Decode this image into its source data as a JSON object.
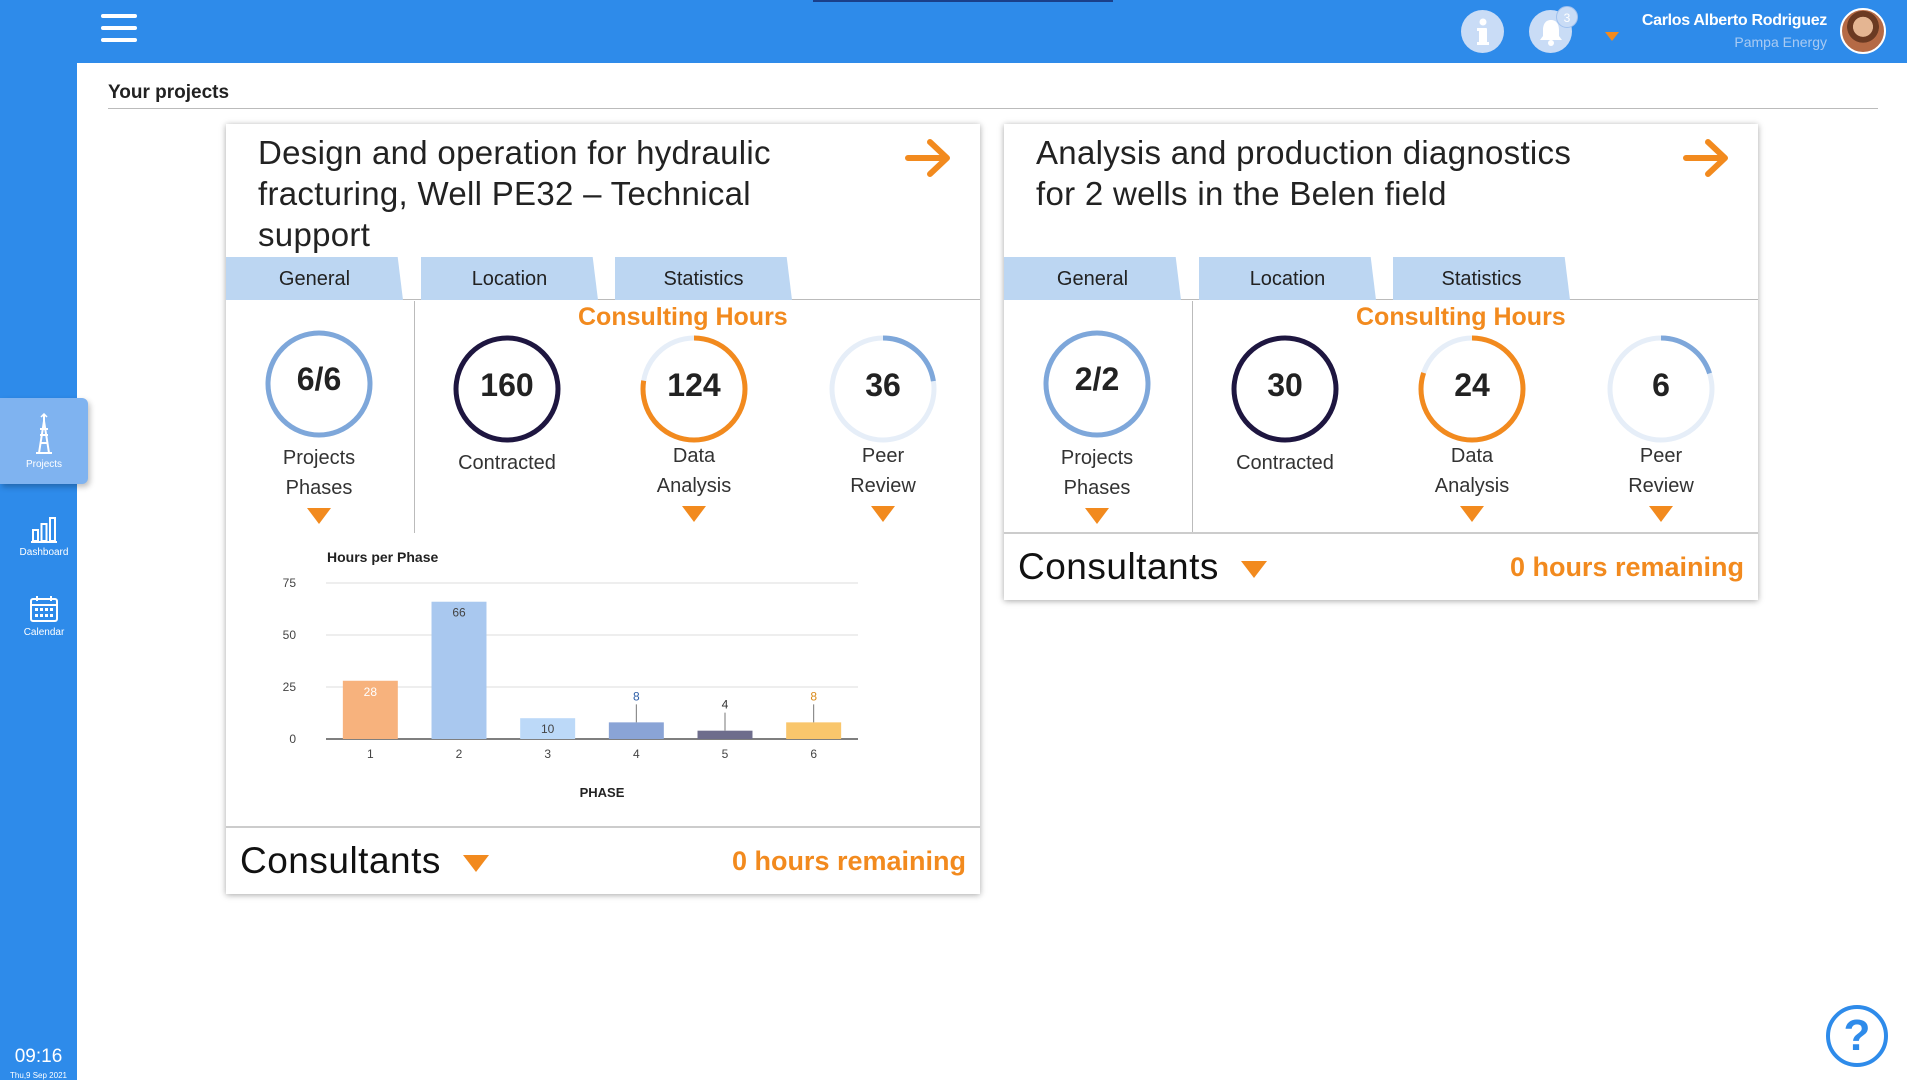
{
  "header": {
    "user_name": "Carlos Alberto Rodriguez",
    "company": "Pampa Energy",
    "notifications_count": "3",
    "icons": [
      "menu-icon",
      "info-icon",
      "bell-icon",
      "caret-down-icon"
    ]
  },
  "sidebar": {
    "items": [
      {
        "label": "Projects",
        "icon": "oil-rig-icon",
        "active": true
      },
      {
        "label": "Dashboard",
        "icon": "bar-chart-icon",
        "active": false
      },
      {
        "label": "Calendar",
        "icon": "calendar-icon",
        "active": false
      }
    ],
    "time": "09:16",
    "date": "Thu,9 Sep 2021"
  },
  "page": {
    "title": "Your projects"
  },
  "colors": {
    "primary": "#2E8BEA",
    "accent": "#F28A1E",
    "tab": "#bcd6f2",
    "dark_ring": "#1e1640"
  },
  "projects": [
    {
      "title": "Design and operation for hydraulic fracturing, Well PE32 – Technical support",
      "tabs": [
        "General",
        "Location",
        "Statistics"
      ],
      "phases": {
        "value": "6/6",
        "label_line1": "Projects",
        "label_line2": "Phases",
        "fraction": 1.0
      },
      "consulting_title": "Consulting Hours",
      "contracted": {
        "value": "160",
        "label": "Contracted",
        "fraction": 1.0
      },
      "data_analysis": {
        "value": "124",
        "label_line1": "Data",
        "label_line2": "Analysis",
        "fraction": 0.775
      },
      "peer_review": {
        "value": "36",
        "label_line1": "Peer",
        "label_line2": "Review",
        "fraction": 0.225
      },
      "consultants_label": "Consultants",
      "hours_remaining": "0 hours remaining"
    },
    {
      "title": "Analysis and production diagnostics for 2 wells in the Belen field",
      "tabs": [
        "General",
        "Location",
        "Statistics"
      ],
      "phases": {
        "value": "2/2",
        "label_line1": "Projects",
        "label_line2": "Phases",
        "fraction": 1.0
      },
      "consulting_title": "Consulting Hours",
      "contracted": {
        "value": "30",
        "label": "Contracted",
        "fraction": 1.0
      },
      "data_analysis": {
        "value": "24",
        "label_line1": "Data",
        "label_line2": "Analysis",
        "fraction": 0.8
      },
      "peer_review": {
        "value": "6",
        "label_line1": "Peer",
        "label_line2": "Review",
        "fraction": 0.2
      },
      "consultants_label": "Consultants",
      "hours_remaining": "0 hours remaining"
    }
  ],
  "chart_data": {
    "type": "bar",
    "title": "Hours per Phase",
    "xlabel": "PHASE",
    "ylabel": "",
    "categories": [
      "1",
      "2",
      "3",
      "4",
      "5",
      "6"
    ],
    "values": [
      28,
      66,
      10,
      8,
      4,
      8
    ],
    "bar_colors": [
      "#F7B27D",
      "#A9C8EF",
      "#BCD9F8",
      "#8AA4D6",
      "#6E6D8C",
      "#F9C66C"
    ],
    "label_colors": [
      "#ffffff",
      "#444444",
      "#444444",
      "#2E5FA8",
      "#333333",
      "#D98A1A"
    ],
    "ylim": [
      0,
      75
    ],
    "yticks": [
      0,
      25,
      50,
      75
    ],
    "grid": true
  },
  "help": {
    "label": "?"
  }
}
